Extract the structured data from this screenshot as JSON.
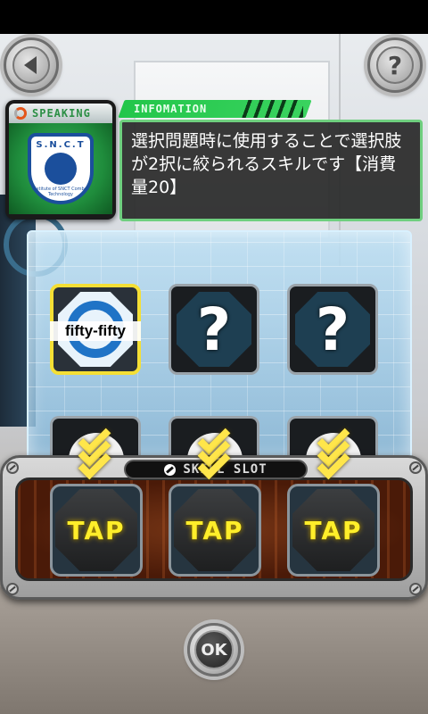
{
  "header": {
    "back_icon": "back-arrow-icon",
    "help_label": "?"
  },
  "speaker": {
    "label": "SPEAKING",
    "emblem_abbr": "S.N.C.T",
    "emblem_motto": "Institute of SNCT Combat Technology"
  },
  "information": {
    "tag": "INFOMATION",
    "text": "選択問題時に使用することで選択肢が2択に絞られるスキルです【消費量20】"
  },
  "skills": {
    "row1": [
      {
        "name": "fifty-fifty",
        "selected": true
      },
      {
        "name": "?",
        "selected": false
      },
      {
        "name": "?",
        "selected": false
      }
    ]
  },
  "slot": {
    "title": "SKILL SLOT",
    "buttons": [
      "TAP",
      "TAP",
      "TAP"
    ]
  },
  "footer": {
    "ok_label": "OK"
  },
  "colors": {
    "accent_green": "#22c64a",
    "tap_yellow": "#ffee2a",
    "selected_border": "#f4df35"
  }
}
